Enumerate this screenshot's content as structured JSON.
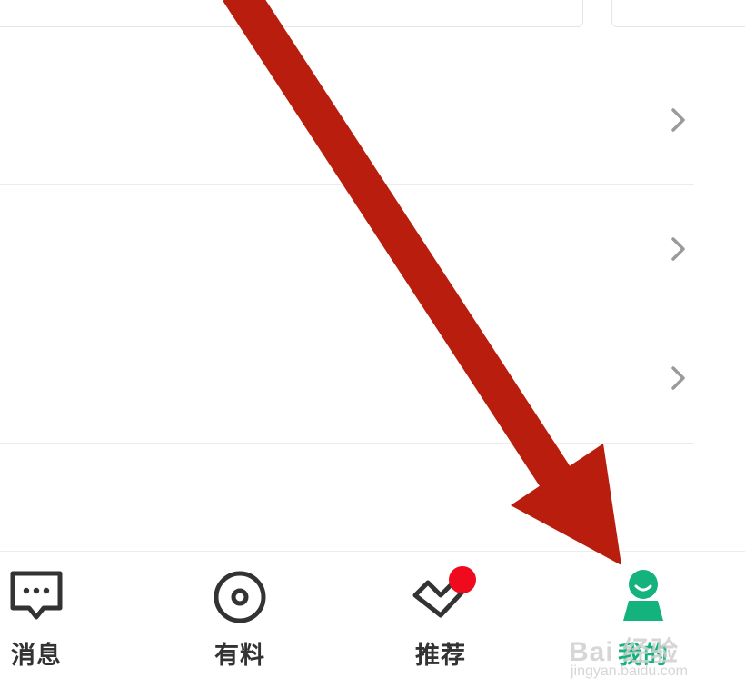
{
  "colors": {
    "accent": "#14b37d",
    "badge": "#f00a1e",
    "annotation_arrow": "#b81d0d",
    "icon": "#333333",
    "divider": "#ececec"
  },
  "list": {
    "rows": [
      {
        "chevron_icon": "chevron-right-icon"
      },
      {
        "chevron_icon": "chevron-right-icon"
      },
      {
        "chevron_icon": "chevron-right-icon"
      }
    ]
  },
  "tabbar": {
    "tabs": [
      {
        "label": "消息",
        "icon": "message-bubble-icon",
        "active": false
      },
      {
        "label": "有料",
        "icon": "target-circle-icon",
        "active": false
      },
      {
        "label": "推荐",
        "icon": "heart-check-icon",
        "active": false,
        "badge": true
      },
      {
        "label": "我的",
        "icon": "person-icon",
        "active": true
      }
    ]
  },
  "watermark": {
    "brand": "Bai 经验",
    "domain": "jingyan.baidu.com"
  }
}
